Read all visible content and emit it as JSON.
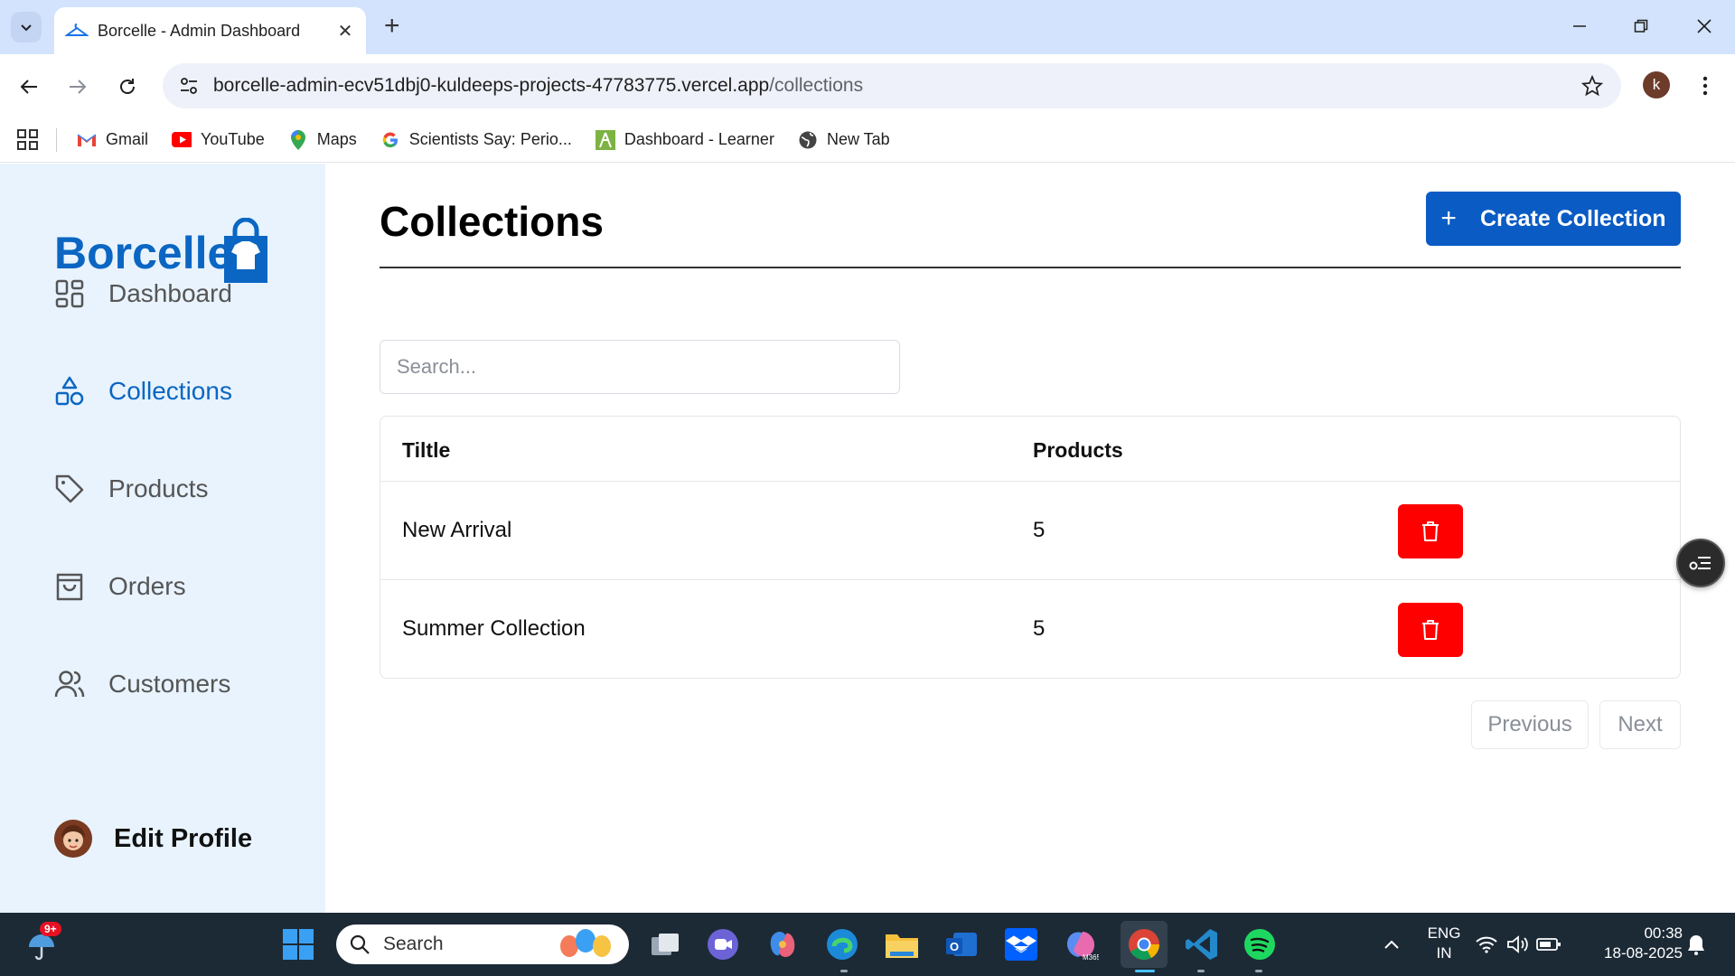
{
  "browser": {
    "tab_title": "Borcelle - Admin Dashboard",
    "url_host": "borcelle-admin-ecv51dbj0-kuldeeps-projects-47783775.vercel.app",
    "url_path": "/collections",
    "profile_initial": "k"
  },
  "bookmarks": [
    {
      "label": "Gmail",
      "icon": "gmail-icon"
    },
    {
      "label": "YouTube",
      "icon": "youtube-icon"
    },
    {
      "label": "Maps",
      "icon": "maps-icon"
    },
    {
      "label": "Scientists Say: Perio...",
      "icon": "google-icon"
    },
    {
      "label": "Dashboard - Learner",
      "icon": "learner-icon"
    },
    {
      "label": "New Tab",
      "icon": "globe-icon"
    }
  ],
  "sidebar": {
    "logo_text": "Borcelle",
    "items": [
      {
        "label": "Dashboard",
        "icon": "dashboard-icon",
        "active": false
      },
      {
        "label": "Collections",
        "icon": "shapes-icon",
        "active": true
      },
      {
        "label": "Products",
        "icon": "tag-icon",
        "active": false
      },
      {
        "label": "Orders",
        "icon": "shopping-bag-icon",
        "active": false
      },
      {
        "label": "Customers",
        "icon": "users-icon",
        "active": false
      }
    ],
    "profile_label": "Edit Profile"
  },
  "main": {
    "title": "Collections",
    "create_button_label": "Create Collection",
    "search_placeholder": "Search...",
    "table": {
      "headers": [
        "Tiltle",
        "Products"
      ],
      "rows": [
        {
          "title": "New Arrival",
          "products": "5"
        },
        {
          "title": "Summer Collection",
          "products": "5"
        }
      ]
    },
    "pagination": {
      "previous_label": "Previous",
      "next_label": "Next"
    }
  },
  "taskbar": {
    "notification_badge": "9+",
    "search_label": "Search",
    "language_line1": "ENG",
    "language_line2": "IN",
    "time": "00:38",
    "date": "18-08-2025",
    "m365_label": "M365"
  },
  "colors": {
    "accent": "#0a5bc4",
    "delete": "#ff0000",
    "sidebar_bg": "#e8f3fe",
    "tabbar_bg": "#d3e3fd",
    "taskbar_bg": "#1c2a36"
  }
}
